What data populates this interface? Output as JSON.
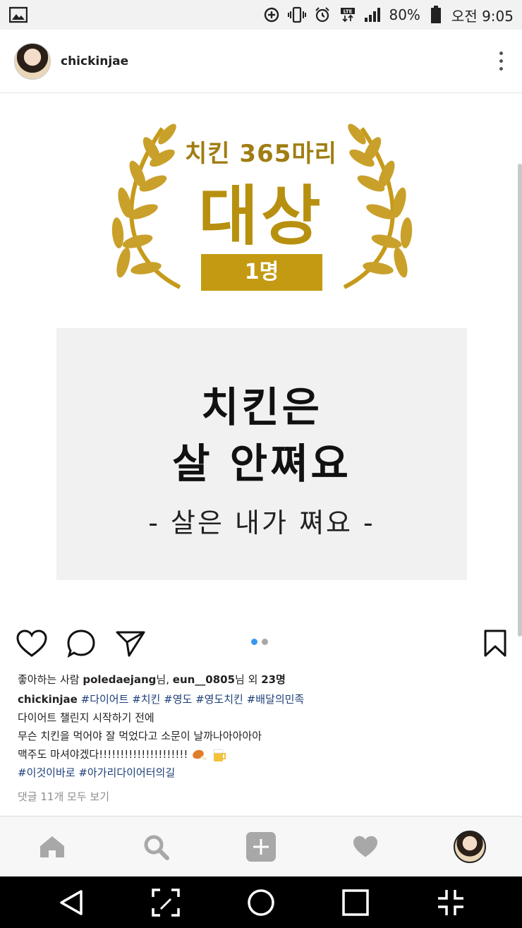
{
  "status_bar": {
    "battery": "80%",
    "time": "오전 9:05",
    "icons": [
      "gallery-icon",
      "data-saver-icon",
      "vibrate-icon",
      "alarm-icon",
      "lte-icon",
      "signal-icon",
      "battery-icon"
    ]
  },
  "post": {
    "username": "chickinjae",
    "image": {
      "award_sub": "치킨 365마리",
      "award_main": "대상",
      "award_badge": "1명",
      "quote_line1": "치킨은",
      "quote_line2": "살 안쪄요",
      "quote_line3": "- 살은 내가 쪄요 -"
    },
    "carousel": {
      "total": 2,
      "active": 0
    },
    "likes": {
      "prefix": "좋아하는 사람 ",
      "user1": "poledaejang",
      "suffix1": "님, ",
      "user2": "eun__0805",
      "suffix2": "님 외 ",
      "count": "23명"
    },
    "caption": {
      "author": "chickinjae",
      "hashtags_line1": [
        "#다이어트",
        "#치킨",
        "#영도",
        "#영도치킨",
        "#배달의민족"
      ],
      "line2": "다이어트 챌린지 시작하기 전에",
      "line3": "무슨 치킨을 먹어야 잘 먹었다고 소문이 날까나아아아아",
      "line4": "맥주도 마셔야겠다!!!!!!!!!!!!!!!!!!!!!",
      "hashtags_line5": [
        "#이것이바로",
        "#아가리다이어터의길"
      ]
    },
    "comments_link": "댓글 11개 모두 보기"
  },
  "colors": {
    "gold": "#b8900f",
    "hashtag": "#1e3f78",
    "dot_active": "#3897f0",
    "dot_inactive": "#a8a8a8"
  }
}
